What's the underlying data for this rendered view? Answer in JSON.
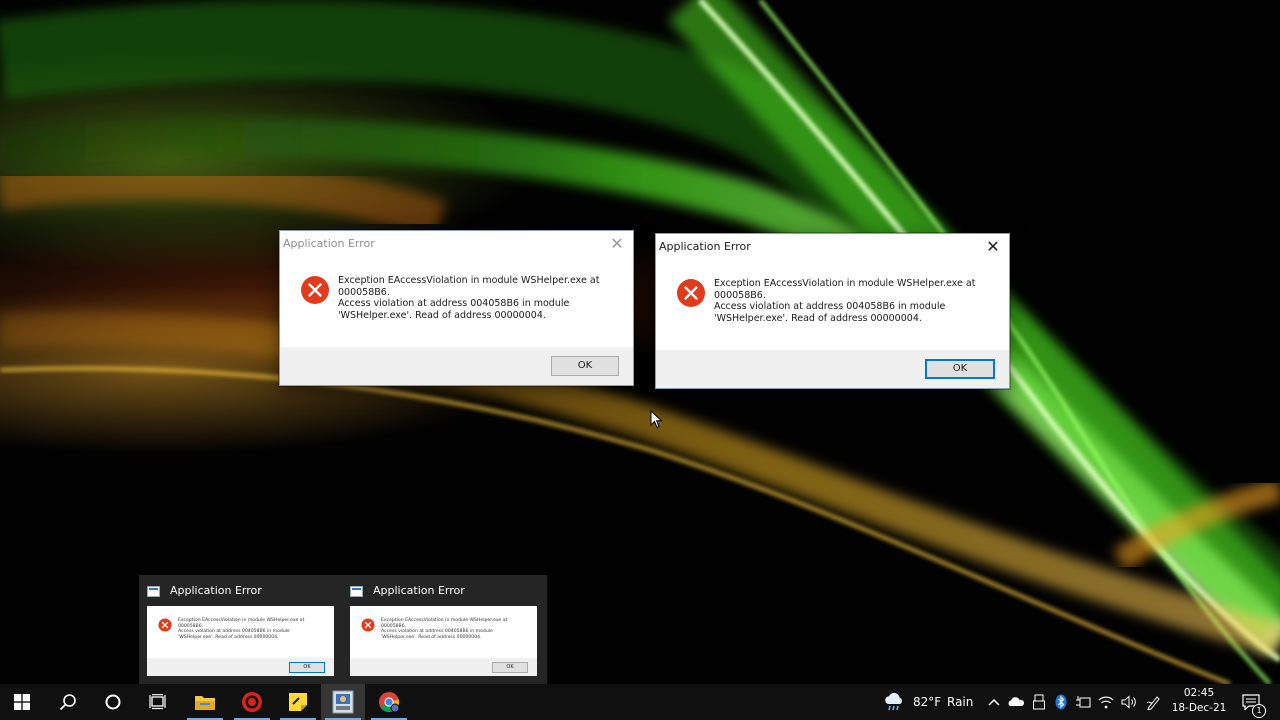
{
  "dialogs": [
    {
      "title": "Application Error",
      "state": "inactive",
      "message_line1": "Exception EAccessViolation in module WSHelper.exe at",
      "message_line2": "000058B6.",
      "message_line3": "Access violation at address 004058B6 in module",
      "message_line4": "'WSHelper.exe'. Read of address 00000004.",
      "ok_label": "OK",
      "close_glyph": "✕"
    },
    {
      "title": "Application Error",
      "state": "active",
      "message_line1": "Exception EAccessViolation in module WSHelper.exe at",
      "message_line2": "000058B6.",
      "message_line3": "Access violation at address 004058B6 in module",
      "message_line4": "'WSHelper.exe'. Read of address 00000004.",
      "ok_label": "OK",
      "close_glyph": "✕"
    }
  ],
  "thumbnails": [
    {
      "title": "Application Error",
      "ok_label": "OK"
    },
    {
      "title": "Application Error",
      "ok_label": "OK"
    }
  ],
  "taskbar": {
    "apps": [
      {
        "name": "start",
        "icon": "windows-logo-icon"
      },
      {
        "name": "search",
        "icon": "search-icon"
      },
      {
        "name": "cortana",
        "icon": "cortana-circle-icon"
      },
      {
        "name": "task-view",
        "icon": "task-view-icon"
      },
      {
        "name": "file-explorer",
        "icon": "folder-icon"
      },
      {
        "name": "red-app",
        "icon": "red-target-icon"
      },
      {
        "name": "sticky-notes",
        "icon": "sticky-notes-icon"
      },
      {
        "name": "wshelper",
        "icon": "wshelper-app-icon"
      },
      {
        "name": "chrome",
        "icon": "chrome-icon"
      }
    ],
    "weather": {
      "temp": "82°F",
      "condition": "Rain",
      "icon": "rain-cloud-icon"
    },
    "tray_icons": [
      "chevron-up-icon",
      "onedrive-icon",
      "usb-device-icon",
      "bluetooth-icon",
      "power-plug-icon",
      "wifi-icon",
      "volume-icon",
      "pen-icon"
    ],
    "clock": {
      "time": "02:45",
      "date": "18-Dec-21"
    },
    "notifications": {
      "count": "1"
    }
  },
  "colors": {
    "accent": "#0078d7",
    "error_red": "#e81123",
    "taskbar_bg": "#101010"
  }
}
